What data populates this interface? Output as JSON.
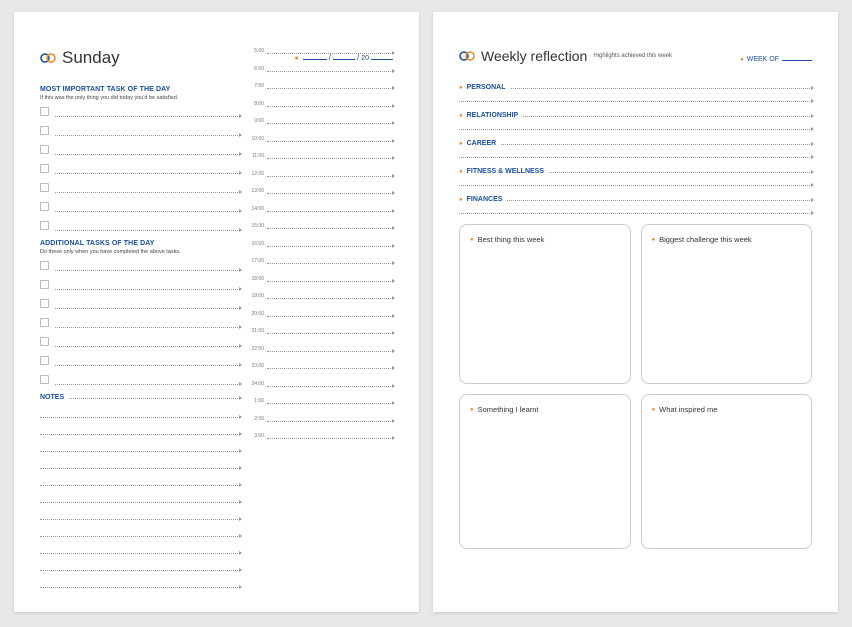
{
  "left": {
    "day": "Sunday",
    "date_prefix20": "20",
    "important_title": "MOST IMPORTANT TASK OF THE DAY",
    "important_sub": "If this was the only thing you did today you'd be satisfied.",
    "additional_title": "ADDITIONAL TASKS OF THE DAY",
    "additional_sub": "Do these only when you have completed the above tasks.",
    "notes_title": "NOTES",
    "times": [
      "5:00",
      "6:00",
      "7:00",
      "8:00",
      "9:00",
      "10:00",
      "11:00",
      "12:00",
      "13:00",
      "14:00",
      "15:00",
      "16:00",
      "17:00",
      "18:00",
      "19:00",
      "20:00",
      "21:00",
      "22:00",
      "23:00",
      "24:00",
      "1:00",
      "2:00",
      "3:00"
    ]
  },
  "right": {
    "title": "Weekly reflection",
    "subtitle": "Highlights achieved this week",
    "week_of": "WEEK OF",
    "cats": [
      "PERSONAL",
      "RELATIONSHIP",
      "CAREER",
      "FITNESS & WELLNESS",
      "FINANCES"
    ],
    "boxes": {
      "best": "Best thing this week",
      "challenge": "Biggest challenge this week",
      "learnt": "Something I learnt",
      "inspired": "What inspired me"
    }
  }
}
